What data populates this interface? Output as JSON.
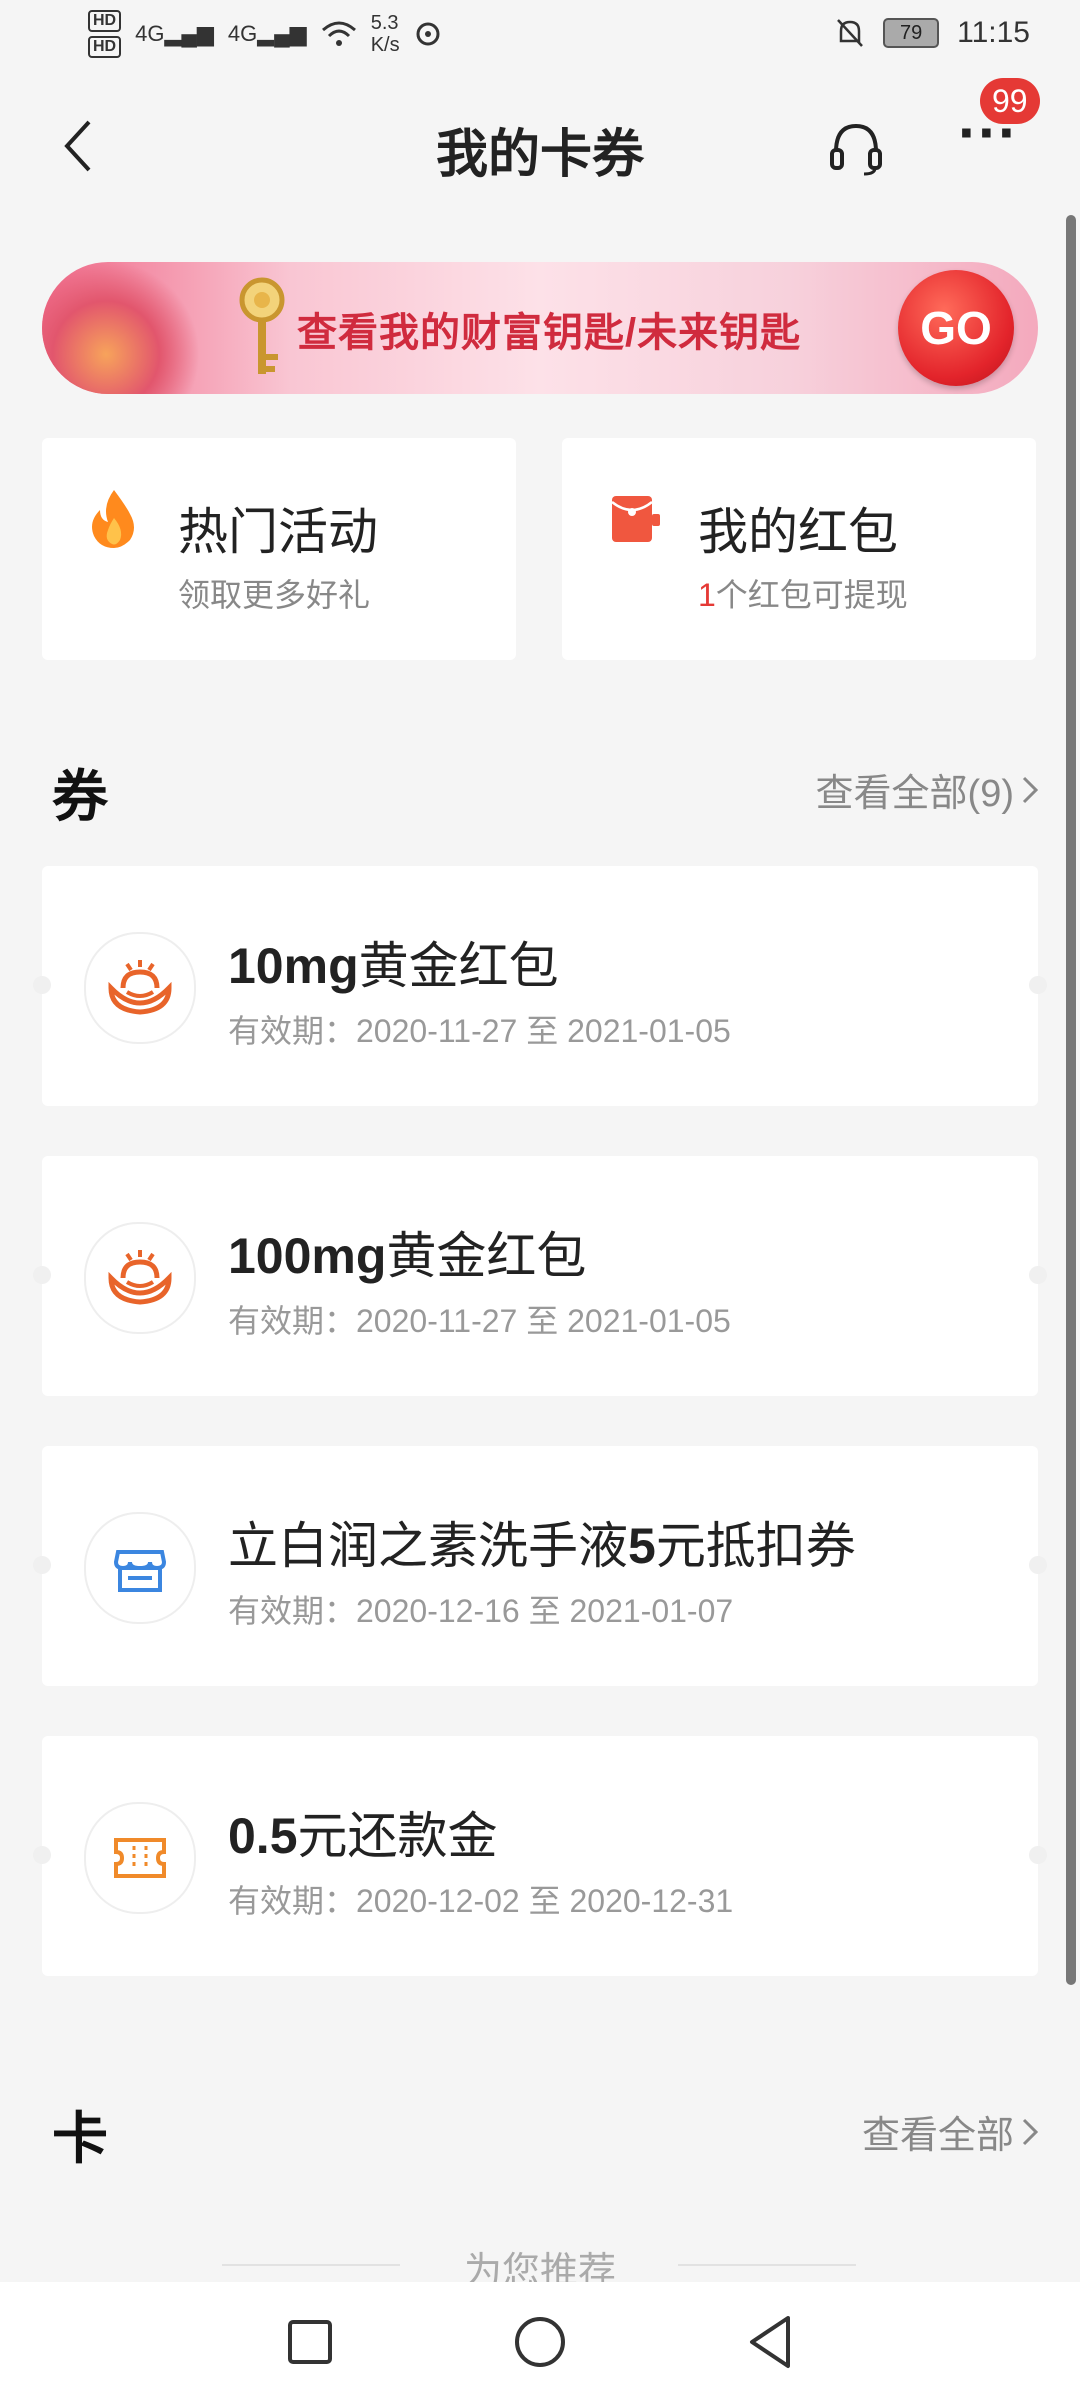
{
  "status_bar": {
    "hd1": "HD",
    "hd2": "HD",
    "net1": "4G",
    "net2": "4G",
    "speed_top": "5.3",
    "speed_bottom": "K/s",
    "battery": "79",
    "time": "11:15"
  },
  "header": {
    "title": "我的卡券",
    "badge": "99",
    "more_label": "···"
  },
  "banner": {
    "text": "查看我的财富钥匙/未来钥匙",
    "go_label": "GO"
  },
  "tiles": [
    {
      "label": "热门活动",
      "sub": "领取更多好礼"
    },
    {
      "label": "我的红包",
      "sub_count": "1",
      "sub_rest": "个红包可提现"
    }
  ],
  "coupons_section": {
    "title": "券",
    "view_all": "查看全部(9)"
  },
  "coupons": [
    {
      "name_bold": "10mg",
      "name_rest": "黄金红包",
      "date": "有效期：2020-11-27 至 2021-01-05"
    },
    {
      "name_bold": "100mg",
      "name_rest": "黄金红包",
      "date": "有效期：2020-11-27 至 2021-01-05"
    },
    {
      "name_pre": "立白润之素洗手液",
      "name_bold": "5",
      "name_rest": "元抵扣券",
      "date": "有效期：2020-12-16 至 2021-01-07"
    },
    {
      "name_bold": "0.5",
      "name_rest": "元还款金",
      "date": "有效期：2020-12-02 至 2020-12-31"
    }
  ],
  "cards_section": {
    "title": "卡",
    "view_all": "查看全部"
  },
  "recommend": {
    "text": "为您推荐"
  },
  "colors": {
    "accent_red": "#e53935",
    "icon_orange": "#e8642a",
    "icon_blue": "#3b86e0"
  }
}
